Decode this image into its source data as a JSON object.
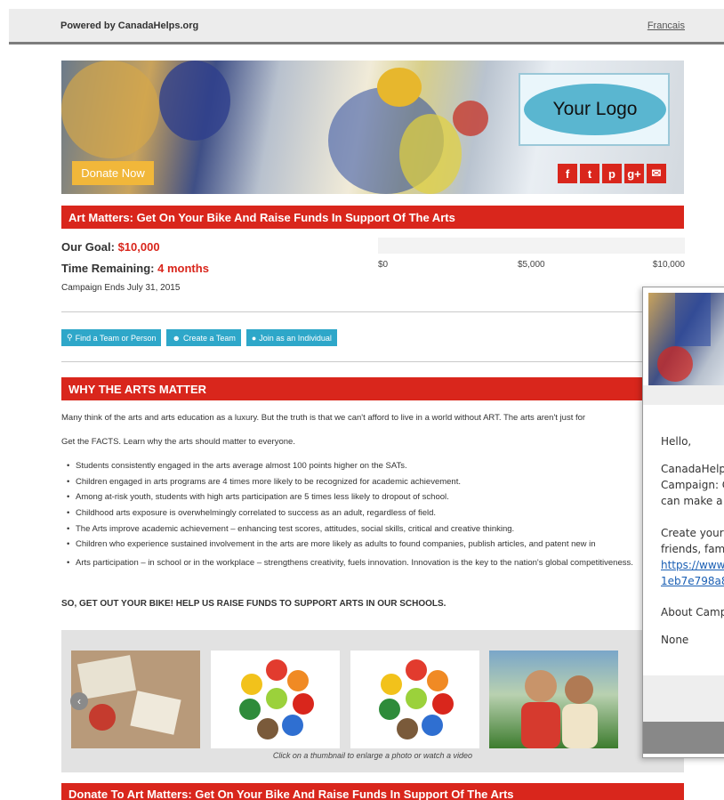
{
  "topbar": {
    "powered": "Powered by CanadaHelps.org",
    "language": "Francais"
  },
  "hero": {
    "logo_text": "Your Logo",
    "donate_label": "Donate Now",
    "social": [
      "f",
      "t",
      "p",
      "g+",
      "✉"
    ]
  },
  "campaign": {
    "title": "Art Matters: Get On Your Bike And Raise Funds In Support Of The Arts",
    "goal_label": "Our Goal:",
    "goal_value": "$10,000",
    "time_label": "Time Remaining:",
    "time_value": "4 months",
    "ends": "Campaign Ends July 31, 2015",
    "progress_fraction": 0,
    "ticks": [
      "$0",
      "$5,000",
      "$10,000"
    ]
  },
  "actions": {
    "find": "Find a Team or Person",
    "create": "Create a Team",
    "join": "Join as an Individual"
  },
  "why": {
    "heading": "WHY THE ARTS MATTER",
    "intro": "Many think of the arts and arts education as a luxury. But the truth is that we can't afford to live in a world without ART. The arts aren't just for",
    "facts": "Get the FACTS. Learn why the arts should matter to everyone.",
    "bullets": [
      "Students consistently engaged in the arts average almost 100 points higher on the SATs.",
      "Children engaged in arts programs are 4 times more likely to be recognized for academic achievement.",
      "Among at-risk youth, students with high arts participation are 5 times less likely to dropout of school.",
      "Childhood arts exposure is overwhelmingly correlated to success as an adult, regardless of field.",
      "The Arts improve academic achievement – enhancing test scores, attitudes, social skills, critical and creative thinking.",
      "Children who experience sustained involvement in the arts are more likely as adults to found companies, publish articles, and patent new in",
      "Arts participation – in school or in the workplace – strengthens creativity, fuels innovation. Innovation is the key to the nation's global competitiveness."
    ],
    "callout": "SO, GET OUT YOUR BIKE!  HELP US RAISE FUNDS TO SUPPORT ARTS IN OUR  SCHOOLS."
  },
  "gallery": {
    "caption": "Click on a thumbnail to enlarge a photo or watch a video"
  },
  "donate_section": {
    "title": "Donate To Art Matters: Get On Your Bike And Raise Funds In Support Of The Arts"
  },
  "popup": {
    "hello": "Hello,",
    "l1": "CanadaHelp",
    "l2": "Campaign: C",
    "l3": "can make a",
    "l4": "Create your",
    "l5": "friends, fami",
    "link1": "https://www.",
    "link2": "1eb7e798a8",
    "about": "About Camp",
    "none": "None"
  },
  "colors": {
    "accent_red": "#d9261c",
    "button_blue": "#2ea7c9",
    "donate_orange": "#f1b73a"
  }
}
